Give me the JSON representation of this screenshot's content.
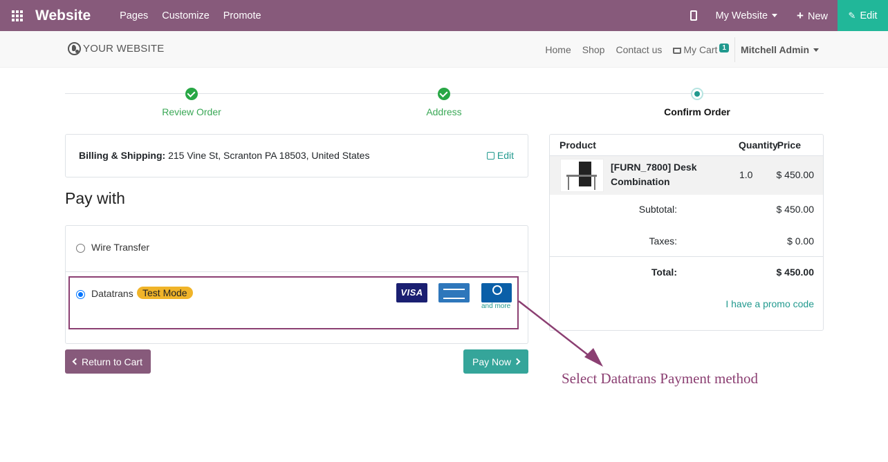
{
  "topbar": {
    "app_name": "Website",
    "menu": [
      "Pages",
      "Customize",
      "Promote"
    ],
    "site_selector": "My Website",
    "new_label": "New",
    "edit_label": "Edit"
  },
  "site": {
    "logo_text": "YOUR WEBSITE",
    "nav": [
      "Home",
      "Shop",
      "Contact us"
    ],
    "cart_label": "My Cart",
    "cart_count": "1",
    "user_name": "Mitchell Admin"
  },
  "wizard": {
    "steps": [
      {
        "label": "Review Order",
        "state": "done"
      },
      {
        "label": "Address",
        "state": "done"
      },
      {
        "label": "Confirm Order",
        "state": "current"
      }
    ]
  },
  "billing": {
    "label": "Billing & Shipping:",
    "address": "215 Vine St, Scranton PA 18503, United States",
    "edit_label": "Edit"
  },
  "payment": {
    "title": "Pay with",
    "methods": [
      {
        "name": "Wire Transfer",
        "selected": false
      },
      {
        "name": "Datatrans",
        "badge": "Test Mode",
        "selected": true,
        "cards": [
          "VISA",
          "American Express",
          "Diners Club"
        ],
        "more_label": "and more"
      }
    ]
  },
  "buttons": {
    "return_label": "Return to Cart",
    "pay_label": "Pay Now"
  },
  "summary": {
    "headers": {
      "product": "Product",
      "quantity": "Quantity",
      "price": "Price"
    },
    "item": {
      "name": "[FURN_7800] Desk Combination",
      "quantity": "1.0",
      "price": "$ 450.00"
    },
    "subtotal_label": "Subtotal:",
    "subtotal": "$ 450.00",
    "taxes_label": "Taxes:",
    "taxes": "$ 0.00",
    "total_label": "Total:",
    "total": "$ 450.00",
    "promo_label": "I have a promo code"
  },
  "annotation": {
    "text": "Select Datatrans Payment method",
    "color": "#8b3f72"
  },
  "colors": {
    "brand": "#875a7b",
    "accent": "#21b799",
    "link": "#21998e",
    "success": "#28a745"
  }
}
